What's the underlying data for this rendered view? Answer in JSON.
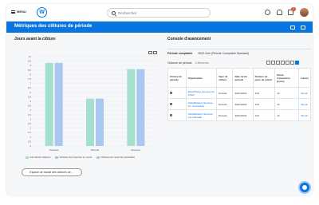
{
  "topbar": {
    "menu_label": "MENU",
    "logo_letter": "W",
    "search_placeholder": "Rechercher",
    "inbox_badge": "2"
  },
  "header": {
    "title": "Métriques des clôtures de période"
  },
  "left": {
    "title": "Jours avant la clôture",
    "work_button_label": "Espace de travail des clôtures de ..."
  },
  "chart_data": {
    "type": "bar",
    "categories": [
      "Trimestre",
      "Période",
      "Exercice"
    ],
    "series": [
      {
        "name": "4 dernières clôtures",
        "values": [
          9.3,
          5.3,
          8.6
        ],
        "color": "#a5e0cf"
      },
      {
        "name": "Clôtures de l'exercice en cours",
        "values": [
          9.3,
          5.3,
          8.6
        ],
        "color": "#a8c8ef"
      }
    ],
    "ylim": [
      0,
      10
    ],
    "yticks": [
      "0",
      "0,5",
      "1",
      "1,5",
      "2",
      "2,5",
      "3",
      "3,5",
      "4",
      "4,5",
      "5",
      "5,5",
      "6",
      "6,5",
      "7",
      "7,5",
      "8",
      "8,5",
      "9",
      "9,5",
      "10"
    ],
    "legend": [
      {
        "label": "4 dernières clôtures",
        "color": "#a5e0cf"
      },
      {
        "label": "Clôtures de l'exercice en cours",
        "color": "#9ad2c2"
      },
      {
        "label": "Clôtures de l'exercice précédent",
        "color": "#a8c8ef"
      }
    ],
    "legend_position": "bottom"
  },
  "right": {
    "title": "Console d'avancement",
    "period_label": "Période comptable",
    "period_value": "2022-Juin (Période Comptable Standard)",
    "table_title": "Clôtures de période",
    "table_count": "3 éléments",
    "columns": [
      "Clôture de période",
      "Organisation",
      "Type de clôture",
      "Date de fin période",
      "Nombre de jours de retard",
      "Durée d'exécution (jours)",
      "Lancer"
    ],
    "rows": [
      {
        "org": "Extra Planet Services Inc (USA)",
        "type": "Période",
        "date": "30/01/2022",
        "late": "215",
        "duration": "14",
        "launch": "Termin"
      },
      {
        "org": "GlobalModern Services, Inc. (Columbia)",
        "type": "Période",
        "date": "30/01/2022",
        "late": "215",
        "duration": "14",
        "launch": "Termin"
      },
      {
        "org": "GlobalModern Services Ltd (Canada)",
        "type": "Période",
        "date": "30/01/2022",
        "late": "216",
        "duration": "14",
        "launch": "Termin"
      }
    ]
  },
  "colors": {
    "accent": "#0875e1",
    "green_bar": "#a5e0cf",
    "blue_bar": "#a8c8ef"
  }
}
